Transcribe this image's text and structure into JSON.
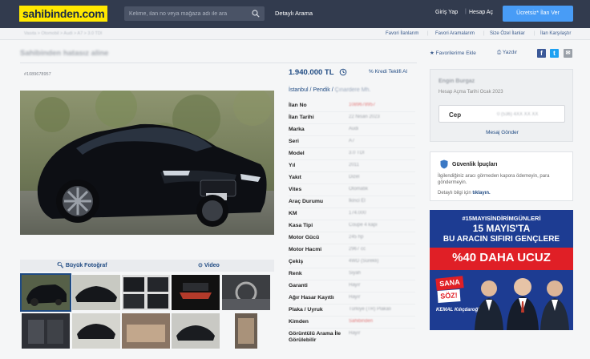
{
  "header": {
    "logo": "sahibinden.com",
    "search_placeholder": "Kelime, ilan no veya mağaza adı ile ara",
    "detayli_arama": "Detaylı Arama",
    "giris_yap": "Giriş Yap",
    "separator": "|",
    "hesap_ac": "Hesap Aç",
    "ilan_ver": "Ücretsiz* İlan Ver"
  },
  "subnav": {
    "breadcrumbs": "Vasıta  >  Otomobil  >  Audi  >  A7  >  3.0 TDI",
    "favori_ilanlarim": "Favori İlanlarım",
    "favori_aramalarim": "Favori Aramalarım",
    "size_ozel": "Size Özel İlanlar",
    "ilan_karsilastir": "İlan Karşılaştır"
  },
  "listing": {
    "title": "Sahibinden hatasız aline",
    "id": "#1089678957",
    "favorilerime_ekle": "Favorilerime Ekle",
    "yazdir": "Yazdır",
    "buyuk_fotograf": "Büyük Fotoğraf",
    "video": "Video",
    "price": "1.940.000 TL",
    "kredi": "Kredi Teklifi Al",
    "location_city": "İstanbul",
    "location_sep1": "/",
    "location_district": "Pendik",
    "location_sep2": "/",
    "location_neighborhood": "Çınardere Mh."
  },
  "specs": [
    {
      "label": "İlan No",
      "value": "1089678957"
    },
    {
      "label": "İlan Tarihi",
      "value": "22 Nisan 2023"
    },
    {
      "label": "Marka",
      "value": "Audi"
    },
    {
      "label": "Seri",
      "value": "A7"
    },
    {
      "label": "Model",
      "value": "3.0 TDI"
    },
    {
      "label": "Yıl",
      "value": "2011"
    },
    {
      "label": "Yakıt",
      "value": "Dizel"
    },
    {
      "label": "Vites",
      "value": "Otomatik"
    },
    {
      "label": "Araç Durumu",
      "value": "İkinci El"
    },
    {
      "label": "KM",
      "value": "174.000"
    },
    {
      "label": "Kasa Tipi",
      "value": "Coupe 4 kapı"
    },
    {
      "label": "Motor Gücü",
      "value": "245 hp"
    },
    {
      "label": "Motor Hacmi",
      "value": "2967 cc"
    },
    {
      "label": "Çekiş",
      "value": "4WD (Sürekli)"
    },
    {
      "label": "Renk",
      "value": "Siyah"
    },
    {
      "label": "Garanti",
      "value": "Hayır"
    },
    {
      "label": "Ağır Hasar Kayıtlı",
      "value": "Hayır"
    },
    {
      "label": "Plaka / Uyruk",
      "value": "Türkiye (TR) Plakalı"
    },
    {
      "label": "Kimden",
      "value": "Sahibinden"
    },
    {
      "label": "Görüntülü Arama İle Görülebilir",
      "value": "Hayır"
    }
  ],
  "seller": {
    "name": "Engin Burgaz",
    "since": "Hesap Açma Tarihi  Ocak 2023",
    "cep_label": "Cep",
    "phone": "0 (536) 4XX XX XX",
    "mesaj": "Mesaj Gönder"
  },
  "safety": {
    "title": "Güvenlik İpuçları",
    "body": "İlgilendiğiniz aracı görmeden kapora ödemeyin, para göndermeyin.",
    "more_prefix": "Detaylı bilgi için",
    "more_link": "tıklayın."
  },
  "ad": {
    "hashtag": "#15MAYISİNDİRİMGÜNLERİ",
    "line1": "15 MAYIS'TA",
    "line2": "BU ARACIN SIFIRI GENÇLERE",
    "line3": "%40 DAHA UCUZ",
    "sana": "SANA",
    "soz": "SÖZ!",
    "kemal": "KEMAL Kılıçdaroğlu"
  },
  "colors": {
    "topbar": "#323b4e",
    "logo_bg": "#ffe800",
    "cta": "#489cf6",
    "link": "#1f4a82",
    "ad_blue": "#1d3c92",
    "ad_red": "#e01f26"
  }
}
